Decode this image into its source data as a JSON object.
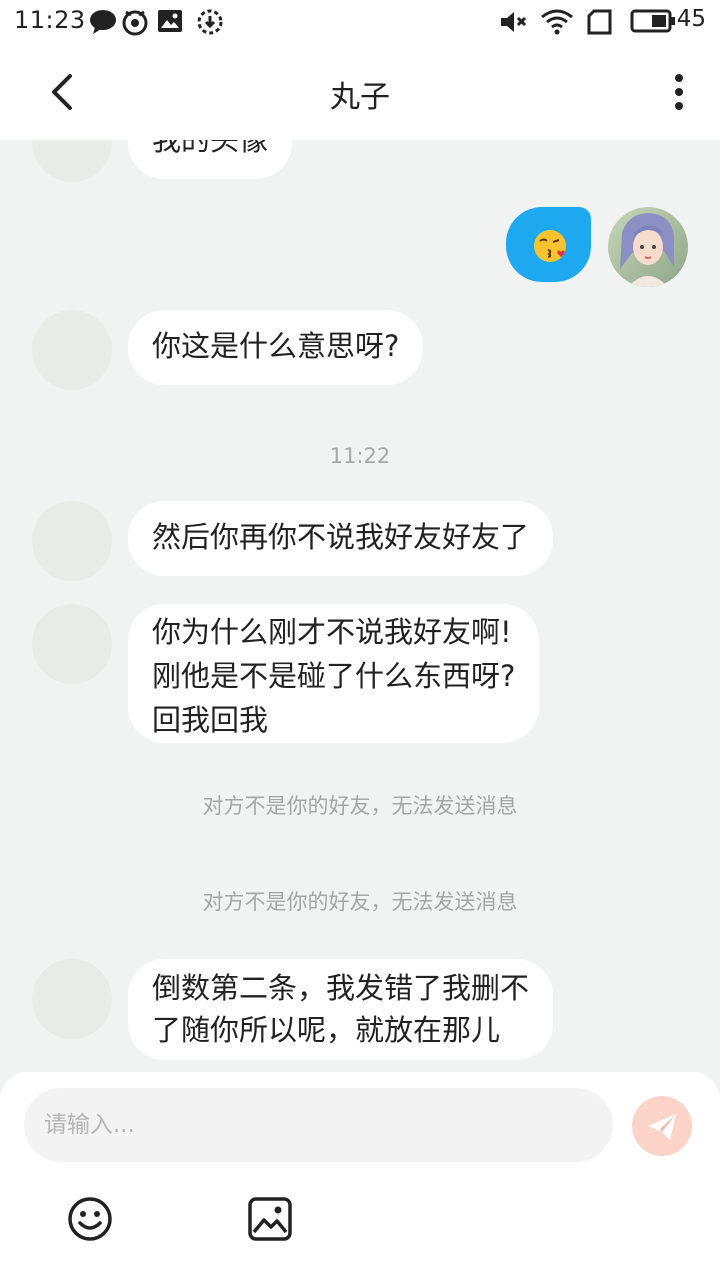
{
  "status_bar": {
    "time": "11:23",
    "battery": "45",
    "icons": [
      "chat-bubble-icon",
      "owl-icon",
      "image-icon",
      "download-icon",
      "mute-icon",
      "wifi-icon",
      "sim-icon",
      "battery-icon"
    ]
  },
  "header": {
    "title": "丸子",
    "back_icon": "chevron-left-icon",
    "more_icon": "more-vertical-icon"
  },
  "messages": [
    {
      "side": "left",
      "text": "我的头像"
    },
    {
      "side": "right",
      "text": "😘"
    },
    {
      "side": "left",
      "text": "你这是什么意思呀?"
    },
    {
      "type": "time",
      "text": "11:22"
    },
    {
      "side": "left",
      "text": "然后你再你不说我好友好友了"
    },
    {
      "side": "left",
      "lines": [
        "你为什么刚才不说我好友啊!",
        "刚他是不是碰了什么东西呀?",
        "回我回我"
      ]
    },
    {
      "type": "system",
      "text": "对方不是你的好友，无法发送消息"
    },
    {
      "type": "system",
      "text": "对方不是你的好友，无法发送消息"
    },
    {
      "side": "left",
      "lines": [
        "倒数第二条，我发错了我删不",
        "了随你所以呢，就放在那儿"
      ]
    }
  ],
  "input": {
    "placeholder": "请输入..."
  },
  "colors": {
    "accent": "#1ea8f0",
    "send_button": "#fbd3c9",
    "background": "#f1f3f3"
  }
}
